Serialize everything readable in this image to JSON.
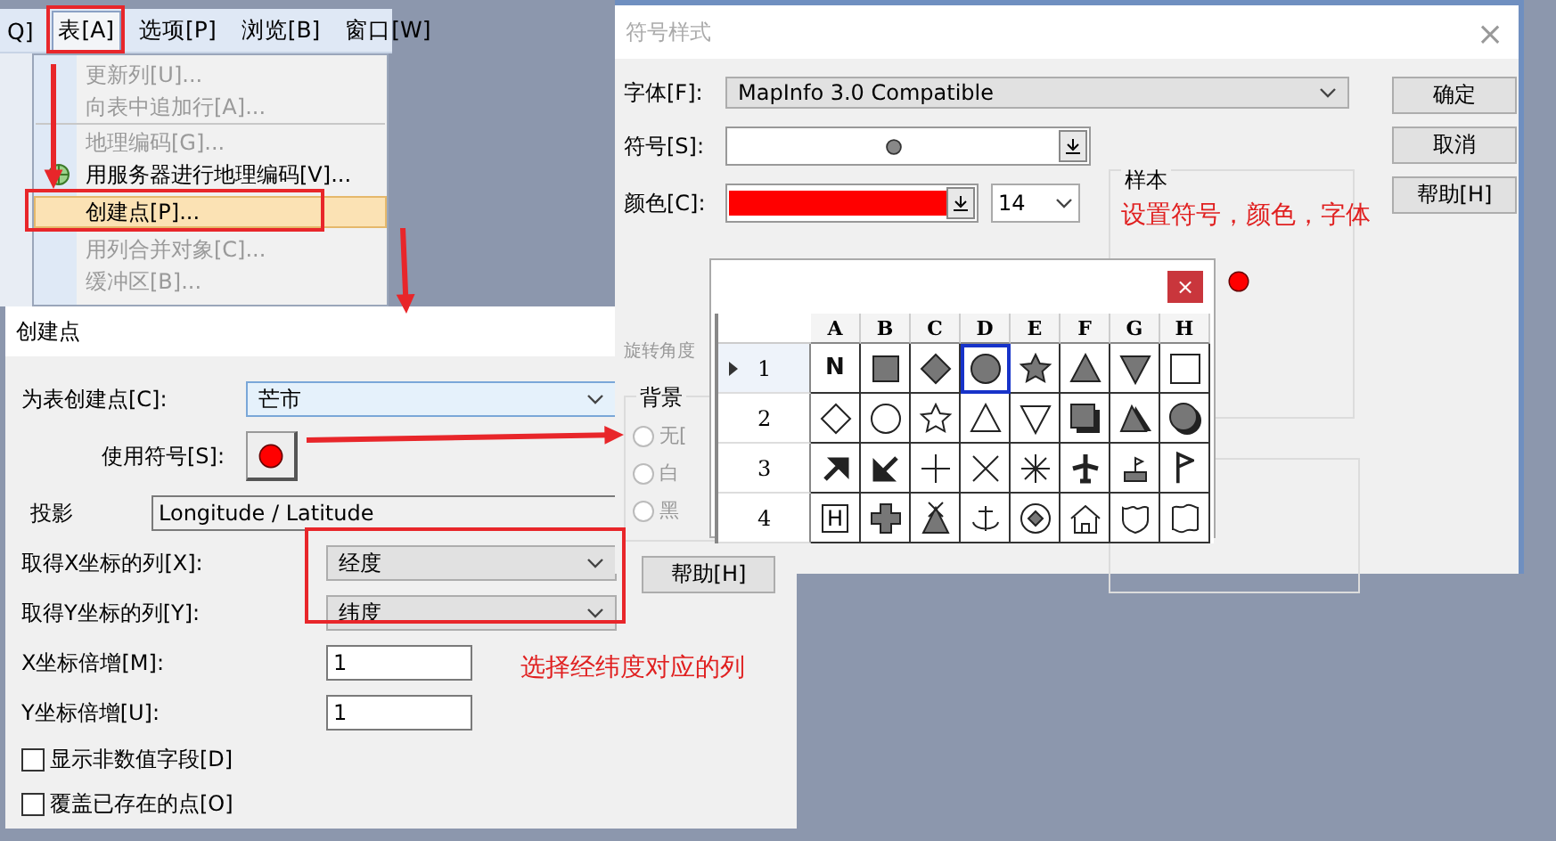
{
  "menu_window": {
    "menubar": [
      {
        "label": "Q]",
        "selected": false
      },
      {
        "label": "表[A]",
        "selected": true
      },
      {
        "label": "选项[P]",
        "selected": false
      },
      {
        "label": "浏览[B]",
        "selected": false
      },
      {
        "label": "窗口[W]",
        "selected": false
      }
    ],
    "menu_items": [
      {
        "label": "更新列[U]...",
        "disabled": true,
        "selected": false,
        "separator_after": false,
        "icon": false
      },
      {
        "label": "向表中追加行[A]...",
        "disabled": true,
        "selected": false,
        "separator_after": true,
        "icon": false
      },
      {
        "label": "地理编码[G]...",
        "disabled": true,
        "selected": false,
        "separator_after": false,
        "icon": false
      },
      {
        "label": "用服务器进行地理编码[V]...",
        "disabled": false,
        "selected": false,
        "separator_after": false,
        "icon": true
      },
      {
        "label": "创建点[P]...",
        "disabled": false,
        "selected": true,
        "separator_after": false,
        "icon": false
      },
      {
        "label": "用列合并对象[C]...",
        "disabled": true,
        "selected": false,
        "separator_after": false,
        "icon": false
      },
      {
        "label": "缓冲区[B]...",
        "disabled": true,
        "selected": false,
        "separator_after": false,
        "icon": false
      }
    ]
  },
  "symbol_dialog": {
    "title": "符号样式",
    "close": "×",
    "font_label": "字体[F]:",
    "font_value": "MapInfo 3.0 Compatible",
    "symbol_label": "符号[S]:",
    "color_label": "颜色[C]:",
    "color": "#ff0000",
    "size": "14",
    "rotation_label": "旋转角度",
    "background_group": "背景",
    "background_options": [
      {
        "label": "无[",
        "selected": false
      },
      {
        "label": "白",
        "selected": false
      },
      {
        "label": "黑",
        "selected": false
      }
    ],
    "sample_group": "样本",
    "buttons": [
      "确定",
      "取消",
      "帮助[H]"
    ],
    "help_button": "帮助[H]"
  },
  "symbol_picker": {
    "close": "×",
    "columns": [
      "A",
      "B",
      "C",
      "D",
      "E",
      "F",
      "G",
      "H"
    ],
    "rows": [
      {
        "label": "1",
        "selected": true,
        "cells": [
          {
            "kind": "letter",
            "text": "N",
            "selected": false
          },
          {
            "kind": "square",
            "selected": false
          },
          {
            "kind": "diamond",
            "selected": false
          },
          {
            "kind": "circle",
            "selected": true
          },
          {
            "kind": "star",
            "selected": false
          },
          {
            "kind": "triangle",
            "selected": false
          },
          {
            "kind": "triangle-down",
            "selected": false
          },
          {
            "kind": "square-outline",
            "selected": false
          }
        ]
      },
      {
        "label": "2",
        "selected": false,
        "cells": [
          {
            "kind": "diamond-outline",
            "selected": false
          },
          {
            "kind": "circle-outline",
            "selected": false
          },
          {
            "kind": "star-outline",
            "selected": false
          },
          {
            "kind": "triangle-outline",
            "selected": false
          },
          {
            "kind": "triangle-down-outline",
            "selected": false
          },
          {
            "kind": "cube",
            "selected": false
          },
          {
            "kind": "pyramid",
            "selected": false
          },
          {
            "kind": "sphere",
            "selected": false
          }
        ]
      },
      {
        "label": "3",
        "selected": false,
        "cells": [
          {
            "kind": "arrow-ne",
            "selected": false
          },
          {
            "kind": "arrow-sw",
            "selected": false
          },
          {
            "kind": "plus",
            "selected": false
          },
          {
            "kind": "cross",
            "selected": false
          },
          {
            "kind": "asterisk",
            "selected": false
          },
          {
            "kind": "airplane",
            "selected": false
          },
          {
            "kind": "flag-base",
            "selected": false
          },
          {
            "kind": "flag",
            "selected": false
          }
        ]
      },
      {
        "label": "4",
        "selected": false,
        "cells": [
          {
            "kind": "letter-box",
            "text": "H",
            "selected": false
          },
          {
            "kind": "fat-cross",
            "selected": false
          },
          {
            "kind": "tent",
            "selected": false
          },
          {
            "kind": "anchor",
            "selected": false
          },
          {
            "kind": "target",
            "selected": false
          },
          {
            "kind": "house",
            "selected": false
          },
          {
            "kind": "shield",
            "selected": false
          },
          {
            "kind": "badge",
            "selected": false
          }
        ]
      }
    ]
  },
  "create_point_dialog": {
    "title": "创建点",
    "table_label": "为表创建点[C]:",
    "table_value": "芒市",
    "symbol_label": "使用符号[S]:",
    "color": "#ff0000",
    "projection_label": "投影",
    "projection_value": "Longitude / Latitude",
    "x_column_label": "取得X坐标的列[X]:",
    "x_column_value": "经度",
    "y_column_label": "取得Y坐标的列[Y]:",
    "y_column_value": "纬度",
    "x_multiplier_label": "X坐标倍增[M]:",
    "x_multiplier_value": "1",
    "y_multiplier_label": "Y坐标倍增[U]:",
    "y_multiplier_value": "1",
    "checkboxes": [
      {
        "label": "显示非数值字段[D]",
        "checked": false
      },
      {
        "label": "覆盖已存在的点[O]",
        "checked": false
      }
    ]
  },
  "annotations": [
    "设置符号，颜色，字体",
    "选择经纬度对应的列"
  ]
}
